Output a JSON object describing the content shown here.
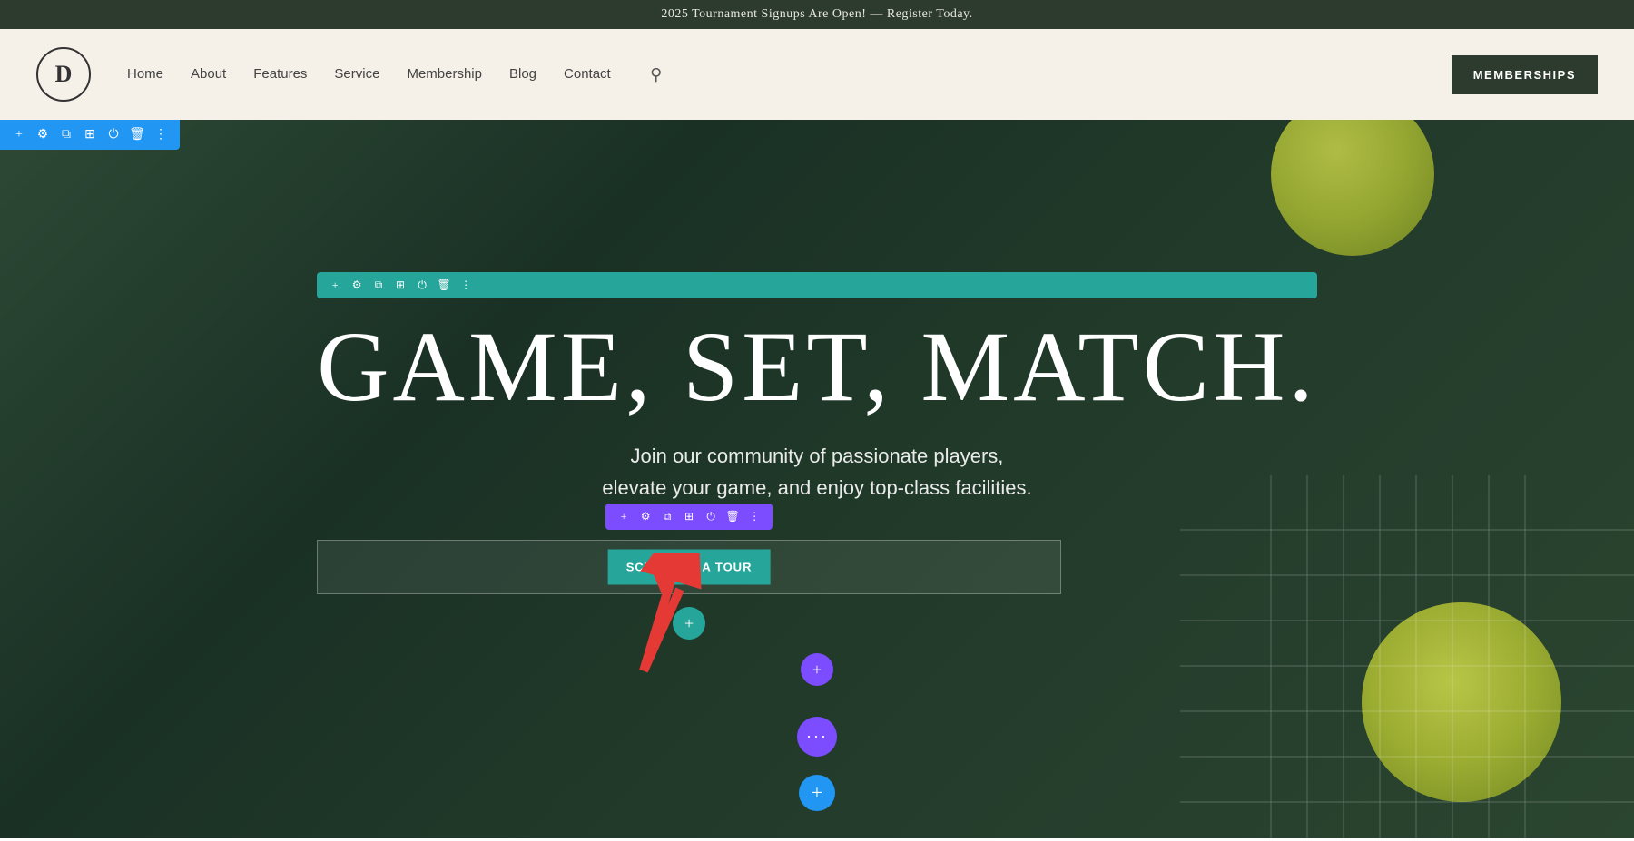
{
  "announcement": {
    "text": "2025 Tournament Signups Are Open! — Register Today."
  },
  "nav": {
    "logo_letter": "D",
    "links": [
      {
        "label": "Home",
        "id": "home"
      },
      {
        "label": "About",
        "id": "about"
      },
      {
        "label": "Features",
        "id": "features"
      },
      {
        "label": "Service",
        "id": "service"
      },
      {
        "label": "Membership",
        "id": "membership"
      },
      {
        "label": "Blog",
        "id": "blog"
      },
      {
        "label": "Contact",
        "id": "contact"
      }
    ],
    "cta_label": "MEMBERSHIPS"
  },
  "hero": {
    "title": "GAME, SET, MATCH.",
    "subtitle_line1": "Join our community of passionate players,",
    "subtitle_line2": "elevate your game, and enjoy top-class facilities.",
    "cta_button": "SCHEDULE A TOUR"
  },
  "toolbar": {
    "icons": [
      "+",
      "⚙",
      "□",
      "⊞",
      "⏻",
      "🗑",
      "⋮"
    ]
  }
}
